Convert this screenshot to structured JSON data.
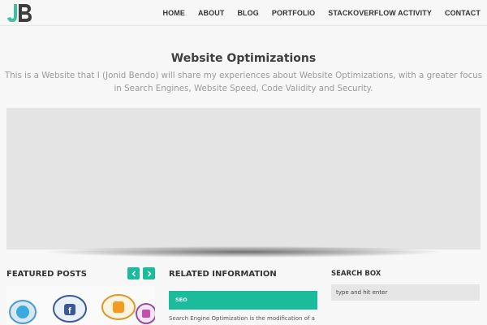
{
  "header": {
    "logo_text": "JB",
    "nav": [
      "HOME",
      "ABOUT",
      "BLOG",
      "PORTFOLIO",
      "STACKOVERFLOW ACTIVITY",
      "CONTACT"
    ]
  },
  "hero": {
    "title": "Website Optimizations",
    "subtitle_line1": "This is a Website that I (Jonid Bendo) will share my experiences about Website Optimizations, with a greater focus",
    "subtitle_line2": "in Search Engines, Website Speed, Code Validity and Security."
  },
  "featured": {
    "title": "FEATURED POSTS",
    "prev_icon": "chevron-left-icon",
    "next_icon": "chevron-right-icon"
  },
  "related": {
    "title": "RELATED INFORMATION",
    "tab_label": "SEO",
    "text": "Search Engine Optimization is the modification of a"
  },
  "search": {
    "title": "SEARCH BOX",
    "placeholder": "type and hit enter"
  },
  "colors": {
    "accent": "#1abc9c",
    "logo_green": "#3fbf9f",
    "logo_dark": "#3d3d3d",
    "banner": "#e4e4e4"
  }
}
